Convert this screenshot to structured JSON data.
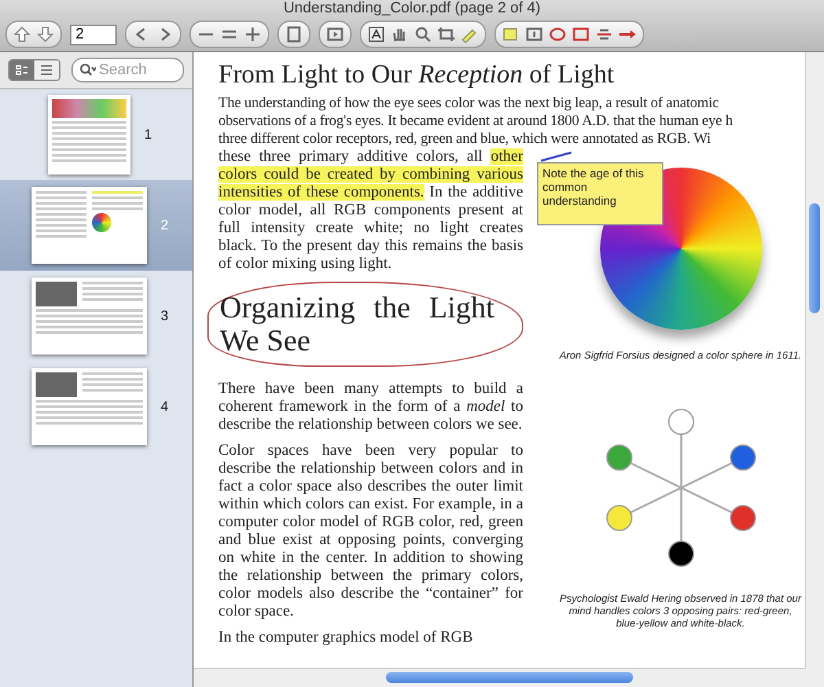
{
  "window": {
    "title": "Understanding_Color.pdf (page 2 of 4)"
  },
  "toolbar": {
    "page_field": "2"
  },
  "sidebar": {
    "view_toggle": [
      {
        "kind": "thumbnails",
        "selected": true
      },
      {
        "kind": "list",
        "selected": false
      }
    ],
    "search": {
      "placeholder": "Search"
    },
    "pages": [
      {
        "label": "1",
        "selected": false,
        "kind": "cover"
      },
      {
        "label": "2",
        "selected": true,
        "kind": "spread"
      },
      {
        "label": "3",
        "selected": false,
        "kind": "photos"
      },
      {
        "label": "4",
        "selected": false,
        "kind": "photos"
      }
    ]
  },
  "document": {
    "heading": "From Light to Our *Reception* of Light",
    "intro_lines": [
      "The understanding of how the eye sees color was the next big leap, a result of anatomic",
      "observations of a frog's eyes. It became evident at around 1800 A.D. that the human eye h",
      "three different color receptors, red, green and blue, which were annotated as RGB. Wi"
    ],
    "intro_column": [
      {
        "text": "these three primary additive colors, all ",
        "highlighted": false
      },
      {
        "text": "other colors could be created by combining various intensities of these components.",
        "highlighted": true
      },
      {
        "text": " In the additive color model, all RGB components present at full intensity create white; no light creates black. To the present day this remains the basis of color mixing using light.",
        "highlighted": false
      }
    ],
    "note": {
      "text": "Note the age of this common understanding"
    },
    "subheading": "Organizing the Light We See",
    "paragraphs": [
      "There have been many attempts to build a coherent framework in the form of a *model* to describe the relationship between colors we see.",
      "Color spaces have been very popular to describe the relationship between colors and in fact a color space also describes the outer limit within which colors can exist. For example, in a computer color model of RGB color, red, green and blue exist at opposing points, converging on white in the center. In addition to showing the relationship between the primary colors, color models also describe the “container” for color space.",
      "In the computer graphics model of RGB"
    ],
    "figures": [
      {
        "kind": "sphere",
        "caption": "Aron Sigfrid Forsius designed a color sphere in 1611."
      },
      {
        "kind": "hering",
        "caption": "Psychologist Ewald Hering observed in 1878 that our mind handles colors 3 opposing pairs: red-green, blue-yellow and white-black.",
        "dots": [
          {
            "color": "#ffffff"
          },
          {
            "color": "#3aa83a"
          },
          {
            "color": "#1f5fe0"
          },
          {
            "color": "#f5e83a"
          },
          {
            "color": "#e0302a"
          },
          {
            "color": "#000000"
          }
        ]
      }
    ]
  }
}
